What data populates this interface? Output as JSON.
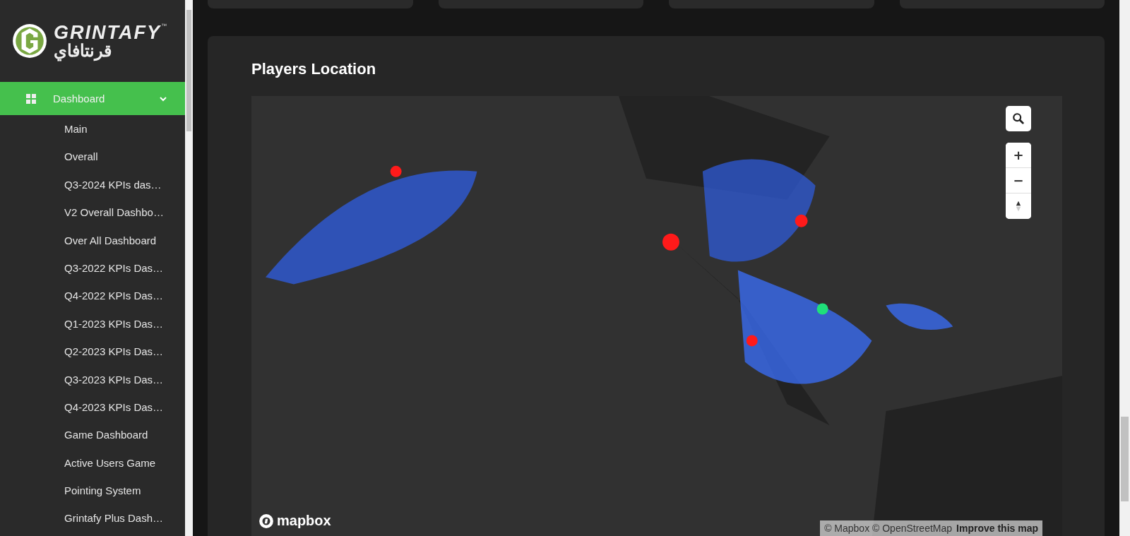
{
  "logo": {
    "name": "GRINTAFY",
    "name_ar": "قرنتافاي",
    "trademark": "™"
  },
  "sidebar": {
    "items": [
      {
        "label": "Dashboard",
        "selected": true,
        "expanded": true,
        "children": [
          {
            "label": "Main"
          },
          {
            "label": "Overall"
          },
          {
            "label": "Q3-2024 KPIs das…"
          },
          {
            "label": "V2 Overall Dashbo…"
          },
          {
            "label": "Over All Dashboard"
          },
          {
            "label": "Q3-2022 KPIs Das…"
          },
          {
            "label": "Q4-2022 KPIs Das…"
          },
          {
            "label": "Q1-2023 KPIs Das…"
          },
          {
            "label": "Q2-2023 KPIs Das…"
          },
          {
            "label": "Q3-2023 KPIs Das…"
          },
          {
            "label": "Q4-2023 KPIs Das…"
          },
          {
            "label": "Game Dashboard"
          },
          {
            "label": "Active Users Game"
          },
          {
            "label": "Pointing System"
          },
          {
            "label": "Grintafy Plus Dash…"
          }
        ]
      }
    ]
  },
  "panel": {
    "title": "Players Location",
    "map": {
      "logo": "mapbox",
      "zoom_in": "+",
      "zoom_out": "−",
      "attribution": "© Mapbox © OpenStreetMap",
      "improve_link": "Improve this map"
    }
  }
}
